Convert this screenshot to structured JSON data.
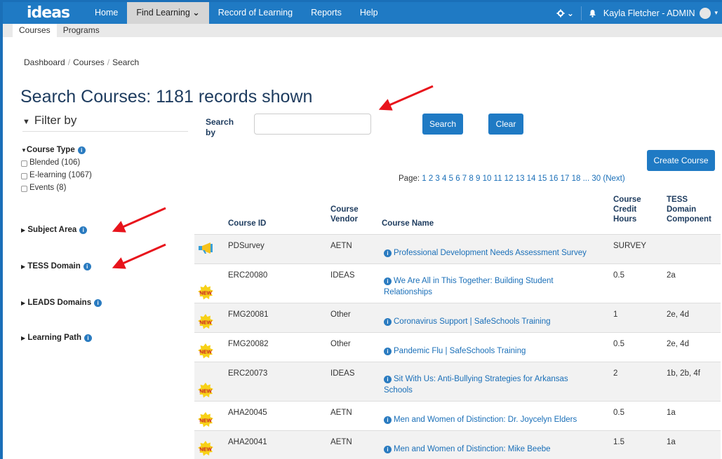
{
  "navbar": {
    "brand": "ideas",
    "items": [
      "Home",
      "Find Learning",
      "Record of Learning",
      "Reports",
      "Help"
    ],
    "find_learning_caret": "⌄",
    "gear_caret": "⌄",
    "user": "Kayla Fletcher - ADMIN",
    "user_caret": "▾"
  },
  "subnav": {
    "tabs": [
      "Courses",
      "Programs"
    ]
  },
  "breadcrumb": [
    "Dashboard",
    "Courses",
    "Search"
  ],
  "page_title": "Search Courses: 1181 records shown",
  "sidebar": {
    "filter_label": "Filter by",
    "course_type_title": "Course Type",
    "course_types": [
      "Blended (106)",
      "E-learning (1067)",
      "Events (8)"
    ],
    "sections": [
      "Subject Area",
      "TESS Domain",
      "LEADS Domains",
      "Learning Path"
    ]
  },
  "search": {
    "label": "Search by",
    "input_value": "",
    "search_button": "Search",
    "clear_button": "Clear",
    "create_button": "Create Course"
  },
  "pager": {
    "prefix": "Page: ",
    "pages": "1 2 3 4 5 6 7 8 9 10 11 12 13 14 15 16 17 18 ... 30 (Next)"
  },
  "table": {
    "headers": {
      "course_id": "Course ID",
      "vendor": "Course Vendor",
      "name": "Course Name",
      "hours": "Course Credit Hours",
      "tess": "TESS Domain Component"
    },
    "rows": [
      {
        "badge": "megaphone",
        "id": "PDSurvey",
        "vendor": "AETN",
        "name": "Professional Development Needs Assessment Survey",
        "hours": "SURVEY",
        "tess": ""
      },
      {
        "badge": "new",
        "id": "ERC20080",
        "vendor": "IDEAS",
        "name": "We Are All in This Together: Building Student Relationships",
        "hours": "0.5",
        "tess": "2a"
      },
      {
        "badge": "new",
        "id": "FMG20081",
        "vendor": "Other",
        "name": "Coronavirus Support | SafeSchools Training",
        "hours": "1",
        "tess": "2e, 4d"
      },
      {
        "badge": "new",
        "id": "FMG20082",
        "vendor": "Other",
        "name": "Pandemic Flu | SafeSchools Training",
        "hours": "0.5",
        "tess": "2e, 4d"
      },
      {
        "badge": "new",
        "id": "ERC20073",
        "vendor": "IDEAS",
        "name": "Sit With Us: Anti-Bullying Strategies for Arkansas Schools",
        "hours": "2",
        "tess": "1b, 2b, 4f"
      },
      {
        "badge": "new",
        "id": "AHA20045",
        "vendor": "AETN",
        "name": "Men and Women of Distinction: Dr. Joycelyn Elders",
        "hours": "0.5",
        "tess": "1a"
      },
      {
        "badge": "new",
        "id": "AHA20041",
        "vendor": "AETN",
        "name": "Men and Women of Distinction: Mike Beebe",
        "hours": "1.5",
        "tess": "1a"
      }
    ]
  },
  "badge_text": "NEW",
  "info_glyph": "i",
  "colors": {
    "nav": "#1f7ac4",
    "title": "#1d3b5e",
    "link": "#1a6fb8",
    "arrow": "#e8141c",
    "new_badge": "#f7d117"
  }
}
